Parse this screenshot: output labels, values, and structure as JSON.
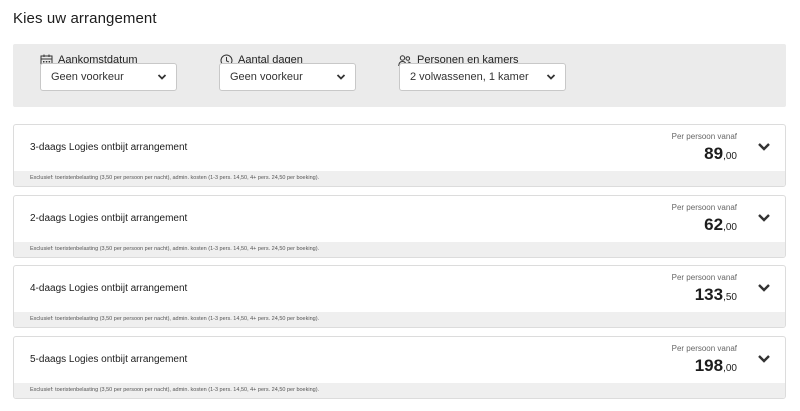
{
  "page": {
    "title": "Kies uw arrangement"
  },
  "filters": {
    "arrival": {
      "label": "Aankomstdatum",
      "value": "Geen voorkeur",
      "icon": "calendar-icon"
    },
    "days": {
      "label": "Aantal dagen",
      "value": "Geen voorkeur",
      "icon": "clock-icon"
    },
    "persons": {
      "label": "Personen en kamers",
      "value": "2 volwassenen, 1 kamer",
      "icon": "persons-icon"
    }
  },
  "packages": [
    {
      "name": "3-daags Logies ontbijt arrangement",
      "per_person": "Per persoon vanaf",
      "price_int": "89",
      "price_dec": ",00",
      "note": "Exclusief: toeristenbelasting (3,50 per persoon per nacht), admin. kosten (1-3 pers. 14,50, 4+ pers. 24,50 per boeking)."
    },
    {
      "name": "2-daags Logies ontbijt arrangement",
      "per_person": "Per persoon vanaf",
      "price_int": "62",
      "price_dec": ",00",
      "note": "Exclusief: toeristenbelasting (3,50 per persoon per nacht), admin. kosten (1-3 pers. 14,50, 4+ pers. 24,50 per boeking)."
    },
    {
      "name": "4-daags Logies ontbijt arrangement",
      "per_person": "Per persoon vanaf",
      "price_int": "133",
      "price_dec": ",50",
      "note": "Exclusief: toeristenbelasting (3,50 per persoon per nacht), admin. kosten (1-3 pers. 14,50, 4+ pers. 24,50 per boeking)."
    },
    {
      "name": "5-daags Logies ontbijt arrangement",
      "per_person": "Per persoon vanaf",
      "price_int": "198",
      "price_dec": ",00",
      "note": "Exclusief: toeristenbelasting (3,50 per persoon per nacht), admin. kosten (1-3 pers. 14,50, 4+ pers. 24,50 per boeking)."
    }
  ]
}
